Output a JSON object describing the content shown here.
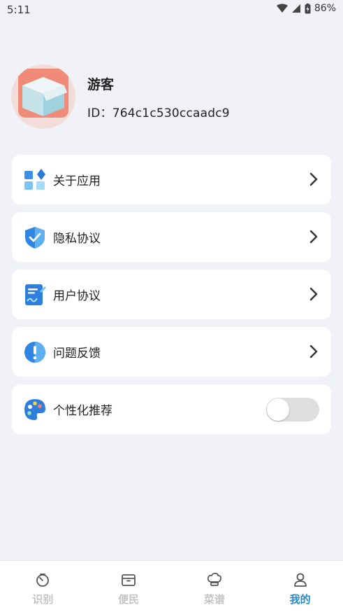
{
  "status_bar": {
    "time": "5:11",
    "battery": "86%"
  },
  "profile": {
    "name": "游客",
    "id": "ID：764c1c530ccaadc9"
  },
  "menu": [
    {
      "label": "关于应用",
      "icon": "grid-apps-icon"
    },
    {
      "label": "隐私协议",
      "icon": "shield-check-icon"
    },
    {
      "label": "用户协议",
      "icon": "document-sign-icon"
    },
    {
      "label": "问题反馈",
      "icon": "exclamation-icon"
    }
  ],
  "personalization": {
    "label": "个性化推荐",
    "icon": "palette-icon",
    "enabled": false
  },
  "bottom_nav": [
    {
      "label": "识别",
      "icon": "timer-icon",
      "active": false
    },
    {
      "label": "便民",
      "icon": "box-icon",
      "active": false
    },
    {
      "label": "菜谱",
      "icon": "chef-hat-icon",
      "active": false
    },
    {
      "label": "我的",
      "icon": "person-icon",
      "active": true
    }
  ],
  "colors": {
    "accent": "#1e8bd0",
    "background": "#f1f2f7",
    "inactive_nav": "#c4c4c4"
  }
}
